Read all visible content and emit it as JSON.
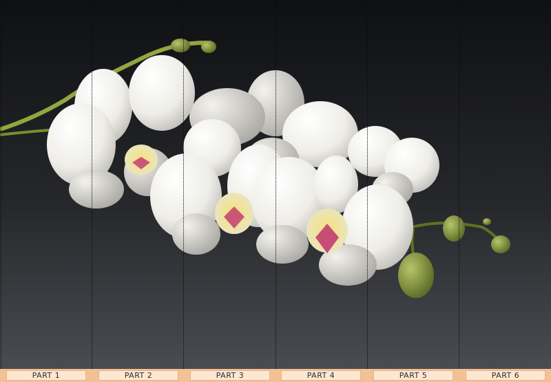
{
  "image": {
    "subject": "white-orchid-branch",
    "colors": {
      "background_top": "#0f1013",
      "background_bottom": "#4a4c51",
      "petal": "#f4f3ef",
      "bud": "#7f9638",
      "lip": "#c0336f",
      "strip": "#f3c193",
      "tab": "#fde7d3"
    }
  },
  "parts": [
    "PART 1",
    "PART 2",
    "PART 3",
    "PART 4",
    "PART 5",
    "PART 6"
  ]
}
